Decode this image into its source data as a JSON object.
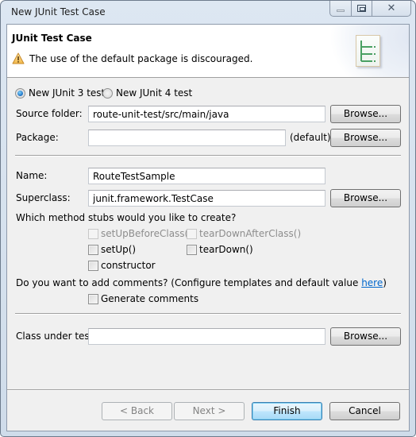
{
  "window": {
    "title": "New JUnit Test Case",
    "controls": {
      "minimize": "minimize-icon",
      "maximize": "maximize-icon",
      "close": "close-icon",
      "close_glyph": "✕"
    }
  },
  "header": {
    "title": "JUnit Test Case",
    "message": "The use of the default package is discouraged.",
    "message_icon": "warning-icon",
    "wizard_icon": "junit-wizard-icon"
  },
  "junit_version": {
    "options": [
      {
        "label": "New JUnit 3 test",
        "checked": true
      },
      {
        "label": "New JUnit 4 test",
        "checked": false
      }
    ]
  },
  "fields": {
    "source_folder": {
      "label": "Source folder:",
      "value": "route-unit-test/src/main/java",
      "browse": "Browse..."
    },
    "package": {
      "label": "Package:",
      "value": "",
      "suffix": "(default)",
      "browse": "Browse..."
    },
    "name": {
      "label": "Name:",
      "value": "RouteTestSample"
    },
    "superclass": {
      "label": "Superclass:",
      "value": "junit.framework.TestCase",
      "browse": "Browse..."
    },
    "class_under_test": {
      "label": "Class under test:",
      "value": "",
      "browse": "Browse..."
    }
  },
  "method_stubs": {
    "question": "Which method stubs would you like to create?",
    "options": [
      {
        "label": "setUpBeforeClass()",
        "checked": false,
        "enabled": false
      },
      {
        "label": "tearDownAfterClass()",
        "checked": false,
        "enabled": false
      },
      {
        "label": "setUp()",
        "checked": false,
        "enabled": true
      },
      {
        "label": "tearDown()",
        "checked": false,
        "enabled": true
      },
      {
        "label": "constructor",
        "checked": false,
        "enabled": true
      }
    ]
  },
  "comments": {
    "question_prefix": "Do you want to add comments? (Configure templates and default value ",
    "link_text": "here",
    "question_suffix": ")",
    "generate_label": "Generate comments",
    "generate_checked": false
  },
  "buttons": {
    "back": "< Back",
    "next": "Next >",
    "finish": "Finish",
    "cancel": "Cancel"
  },
  "colors": {
    "link": "#0066cc",
    "default_button_border": "#3c7fb1",
    "dialog_bg": "#f0f0f0"
  }
}
